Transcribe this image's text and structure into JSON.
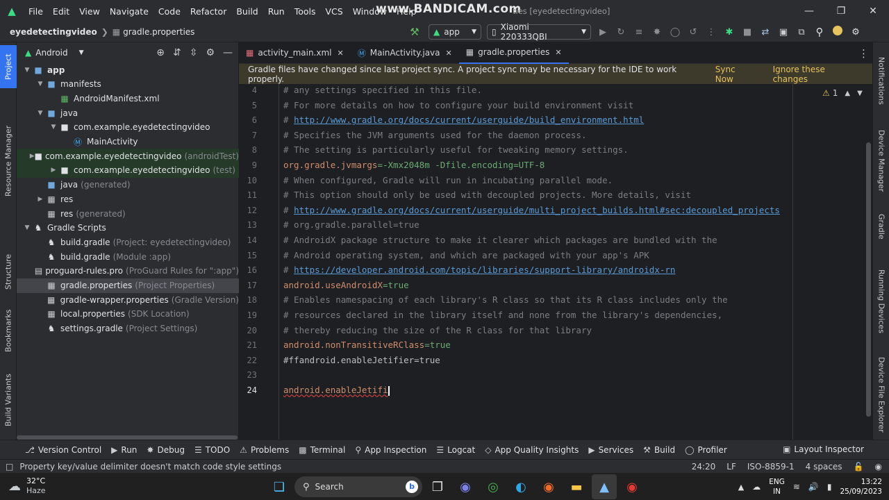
{
  "menubar": {
    "items": [
      "File",
      "Edit",
      "View",
      "Navigate",
      "Code",
      "Refactor",
      "Build",
      "Run",
      "Tools",
      "VCS",
      "Window",
      "Help"
    ],
    "watermark": "www.BANDICAM.com",
    "window_title": "ties [eyedetectingvideo]"
  },
  "nav": {
    "project": "eyedetectingvideo",
    "file": "gradle.properties",
    "run_config": "app",
    "device": "Xiaomi 220333QBI"
  },
  "left_strip": [
    "Project",
    "Resource Manager",
    "Structure",
    "Bookmarks",
    "Build Variants"
  ],
  "right_strip": [
    "Notifications",
    "Device Manager",
    "Gradle",
    "Running Devices",
    "Device File Explorer"
  ],
  "project_panel": {
    "view": "Android",
    "tree": [
      {
        "label": "app",
        "note": "",
        "depth": 0,
        "arrow": "down",
        "icon": "folder-module"
      },
      {
        "label": "manifests",
        "note": "",
        "depth": 1,
        "arrow": "down",
        "icon": "folder"
      },
      {
        "label": "AndroidManifest.xml",
        "note": "",
        "depth": 2,
        "arrow": "",
        "icon": "manifest"
      },
      {
        "label": "java",
        "note": "",
        "depth": 1,
        "arrow": "down",
        "icon": "folder"
      },
      {
        "label": "com.example.eyedetectingvideo",
        "note": "",
        "depth": 2,
        "arrow": "down",
        "icon": "package"
      },
      {
        "label": "MainActivity",
        "note": "",
        "depth": 3,
        "arrow": "",
        "icon": "class"
      },
      {
        "label": "com.example.eyedetectingvideo",
        "note": "(androidTest)",
        "depth": 2,
        "arrow": "right",
        "icon": "package"
      },
      {
        "label": "com.example.eyedetectingvideo",
        "note": "(test)",
        "depth": 2,
        "arrow": "right",
        "icon": "package"
      },
      {
        "label": "java",
        "note": "(generated)",
        "depth": 1,
        "arrow": "",
        "icon": "folder-generated"
      },
      {
        "label": "res",
        "note": "",
        "depth": 1,
        "arrow": "right",
        "icon": "folder-res"
      },
      {
        "label": "res",
        "note": "(generated)",
        "depth": 1,
        "arrow": "",
        "icon": "folder-res"
      },
      {
        "label": "Gradle Scripts",
        "note": "",
        "depth": 0,
        "arrow": "down",
        "icon": "gradle"
      },
      {
        "label": "build.gradle",
        "note": "(Project: eyedetectingvideo)",
        "depth": 1,
        "arrow": "",
        "icon": "gradle"
      },
      {
        "label": "build.gradle",
        "note": "(Module :app)",
        "depth": 1,
        "arrow": "",
        "icon": "gradle"
      },
      {
        "label": "proguard-rules.pro",
        "note": "(ProGuard Rules for \":app\")",
        "depth": 1,
        "arrow": "",
        "icon": "file"
      },
      {
        "label": "gradle.properties",
        "note": "(Project Properties)",
        "depth": 1,
        "arrow": "",
        "icon": "properties"
      },
      {
        "label": "gradle-wrapper.properties",
        "note": "(Gradle Version)",
        "depth": 1,
        "arrow": "",
        "icon": "properties"
      },
      {
        "label": "local.properties",
        "note": "(SDK Location)",
        "depth": 1,
        "arrow": "",
        "icon": "properties"
      },
      {
        "label": "settings.gradle",
        "note": "(Project Settings)",
        "depth": 1,
        "arrow": "",
        "icon": "gradle"
      }
    ]
  },
  "editor": {
    "tabs": [
      {
        "label": "activity_main.xml",
        "icon": "xml-icon"
      },
      {
        "label": "MainActivity.java",
        "icon": "class-icon"
      },
      {
        "label": "gradle.properties",
        "icon": "properties-icon"
      }
    ],
    "banner": {
      "message": "Gradle files have changed since last project sync. A project sync may be necessary for the IDE to work properly.",
      "sync_now": "Sync Now",
      "ignore": "Ignore these changes"
    },
    "warnings": "1",
    "lines": [
      {
        "n": "4",
        "kind": "comment",
        "text": "# any settings specified in this file."
      },
      {
        "n": "5",
        "kind": "comment",
        "text": "# For more details on how to configure your build environment visit"
      },
      {
        "n": "6",
        "kind": "comment-url",
        "prefix": "# ",
        "text": "http://www.gradle.org/docs/current/userguide/build_environment.html"
      },
      {
        "n": "7",
        "kind": "comment",
        "text": "# Specifies the JVM arguments used for the daemon process."
      },
      {
        "n": "8",
        "kind": "comment",
        "text": "# The setting is particularly useful for tweaking memory settings."
      },
      {
        "n": "9",
        "kind": "prop",
        "key": "org.gradle.jvmargs",
        "value": "-Xmx2048m -Dfile.encoding=UTF-8"
      },
      {
        "n": "10",
        "kind": "comment",
        "text": "# When configured, Gradle will run in incubating parallel mode."
      },
      {
        "n": "11",
        "kind": "comment",
        "text": "# This option should only be used with decoupled projects. More details, visit"
      },
      {
        "n": "12",
        "kind": "comment-url",
        "prefix": "# ",
        "text": "http://www.gradle.org/docs/current/userguide/multi_project_builds.html#sec:decoupled_projects"
      },
      {
        "n": "13",
        "kind": "comment",
        "text": "# org.gradle.parallel=true"
      },
      {
        "n": "14",
        "kind": "comment",
        "text": "# AndroidX package structure to make it clearer which packages are bundled with the"
      },
      {
        "n": "15",
        "kind": "comment",
        "text": "# Android operating system, and which are packaged with your app's APK"
      },
      {
        "n": "16",
        "kind": "comment-url",
        "prefix": "# ",
        "text": "https://developer.android.com/topic/libraries/support-library/androidx-rn"
      },
      {
        "n": "17",
        "kind": "prop",
        "key": "android.useAndroidX",
        "value": "true"
      },
      {
        "n": "18",
        "kind": "comment",
        "text": "# Enables namespacing of each library's R class so that its R class includes only the"
      },
      {
        "n": "19",
        "kind": "comment",
        "text": "# resources declared in the library itself and none from the library's dependencies,"
      },
      {
        "n": "20",
        "kind": "comment",
        "text": "# thereby reducing the size of the R class for that library"
      },
      {
        "n": "21",
        "kind": "prop",
        "key": "android.nonTransitiveRClass",
        "value": "true"
      },
      {
        "n": "22",
        "kind": "plain",
        "text": "#ffandroid.enableJetifier=true"
      },
      {
        "n": "23",
        "kind": "plain",
        "text": ""
      },
      {
        "n": "24",
        "kind": "error",
        "text": "android.enableJetifi"
      }
    ]
  },
  "tool_windows": [
    "Version Control",
    "Run",
    "Debug",
    "TODO",
    "Problems",
    "Terminal",
    "App Inspection",
    "Logcat",
    "App Quality Insights",
    "Services",
    "Build",
    "Profiler"
  ],
  "layout_inspector": "Layout Inspector",
  "status": {
    "message": "Property key/value delimiter doesn't match code style settings",
    "position": "24:20",
    "line_sep": "LF",
    "encoding": "ISO-8859-1",
    "indent": "4 spaces"
  },
  "taskbar": {
    "weather_temp": "32°C",
    "weather_desc": "Haze",
    "search": "Search",
    "lang1": "ENG",
    "lang2": "IN",
    "time": "13:22",
    "date": "25/09/2023"
  }
}
